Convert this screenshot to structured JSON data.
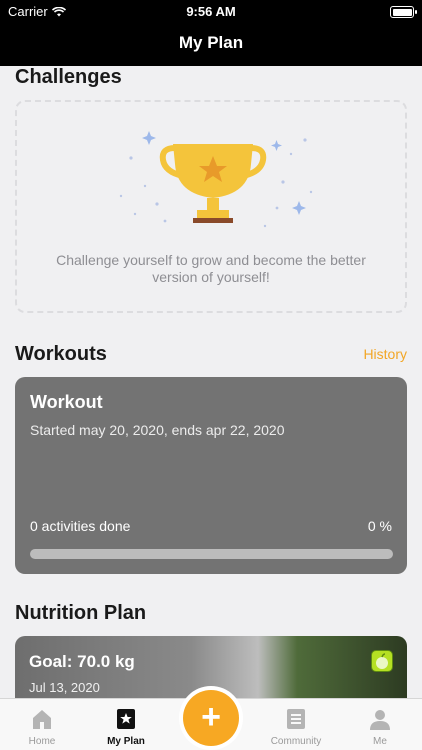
{
  "status_bar": {
    "carrier": "Carrier",
    "time": "9:56 AM"
  },
  "nav": {
    "title": "My Plan"
  },
  "challenges": {
    "title": "Challenges",
    "empty_text": "Challenge yourself to grow and become the better version of yourself!",
    "icon": "trophy-icon"
  },
  "workouts": {
    "title": "Workouts",
    "history_label": "History",
    "card": {
      "title": "Workout",
      "subtitle": "Started may 20, 2020, ends apr 22, 2020",
      "activities": "0 activities done",
      "percent_label": "0 %",
      "progress": 0
    }
  },
  "nutrition": {
    "title": "Nutrition Plan",
    "goal": "Goal: 70.0 kg",
    "date": "Jul 13, 2020",
    "icon": "apple-icon"
  },
  "tabbar": {
    "items": [
      {
        "label": "Home",
        "icon": "home-icon"
      },
      {
        "label": "My Plan",
        "icon": "star-icon"
      },
      {
        "label": "Community",
        "icon": "community-icon"
      },
      {
        "label": "Me",
        "icon": "person-icon"
      }
    ],
    "fab_label": "+"
  },
  "colors": {
    "accent": "#f7a823",
    "card_gray": "#737373",
    "background": "#f0f0f2"
  }
}
